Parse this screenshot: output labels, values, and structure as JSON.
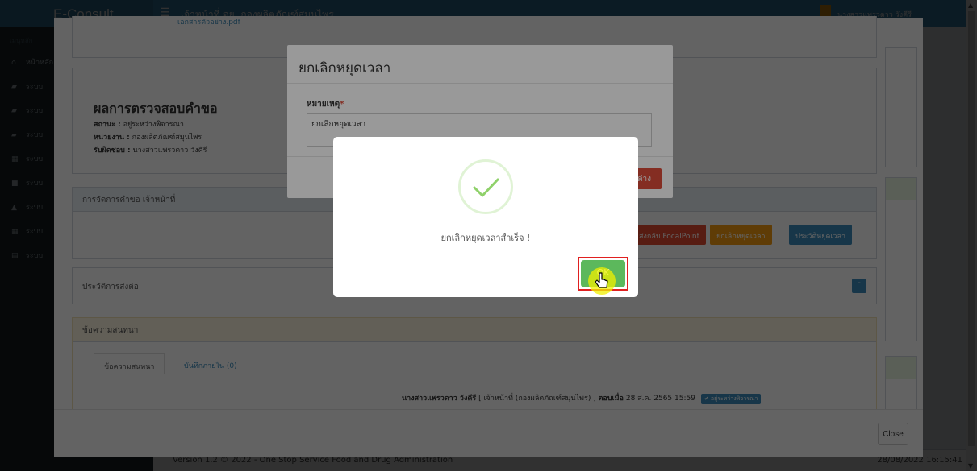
{
  "app": {
    "logo": "E-Consult",
    "header_title": "เจ้าหน้าที่ อย. กองผลิตภัณฑ์สมุนไพร",
    "user_name": "นางสาวแพรวดาว วังคีรี"
  },
  "sidebar": {
    "header": "เมนูหลัก",
    "items": [
      {
        "label": "หน้าหลัก",
        "icon": "home-icon"
      },
      {
        "label": "ระบบ",
        "icon": "book-icon"
      },
      {
        "label": "ระบบ",
        "icon": "book-icon"
      },
      {
        "label": "ระบบ",
        "icon": "book-icon"
      },
      {
        "label": "ระบบ",
        "icon": "calendar-icon"
      },
      {
        "label": "ระบบ",
        "icon": "video-icon"
      },
      {
        "label": "ระบบ",
        "icon": "graduation-cap-icon"
      },
      {
        "label": "ระบบ",
        "icon": "calendar-icon"
      },
      {
        "label": "ระบบ",
        "icon": "file-icon"
      }
    ]
  },
  "main": {
    "attachment": "เอกสารตัวอย่าง.pdf",
    "result_title": "ผลการตรวจสอบคำขอ",
    "status_label": "สถานะ :",
    "status_value": "อยู่ระหว่างพิจารณา",
    "agency_label": "หน่วยงาน :",
    "agency_value": "กองผลิตภัณฑ์สมุนไพร",
    "owner_label": "รับผิดชอบ :",
    "owner_value": "นางสาวแพรวดาว วังคีรี",
    "manage_header": "การจัดการคำขอ เจ้าหน้าที่",
    "btn_focal": "ส่งกลับ FocalPoint",
    "btn_cancel_stop": "ยกเลิกหยุดเวลา",
    "btn_history_stop": "ประวัติหยุดเวลา",
    "forward_history": "ประวัติการส่งต่อ",
    "chat_header": "ข้อความสนทนา",
    "tab_chat": "ข้อความสนทนา",
    "tab_notes": "บันทึกภายใน (0)",
    "msg_author": "นางสาวแพรวดาว วังคีรี",
    "msg_role": "[ เจ้าหน้าที่ (กองผลิตภัณฑ์สมุนไพร) ]",
    "msg_reply_label": "ตอบเมื่อ",
    "msg_date": "28 ส.ค. 2565 15:59",
    "msg_badge": "✔ อยู่ระหว่างพิจารณา"
  },
  "big_modal": {
    "close_label": "Close"
  },
  "cancel_modal": {
    "title": "ยกเลิกหยุดเวลา",
    "field_label": "หมายเหตุ",
    "field_required": "*",
    "field_value": "ยกเลิกหยุดเวลา",
    "submit_label": "ต่าง"
  },
  "alert": {
    "message": "ยกเลิกหยุดเวลาสำเร็จ !",
    "ok_label": "OK"
  },
  "footer": {
    "version": "Version 1.2 © 2022 - One Stop Service Food and Drug Administration",
    "datetime": "28/08/2022 16:15:41"
  },
  "colors": {
    "header_blue": "#3c8dbc",
    "sidebar_dark": "#222d32",
    "ok_green": "#5cb85c",
    "danger_red": "#dd4b39",
    "warning_orange": "#f39c12"
  }
}
